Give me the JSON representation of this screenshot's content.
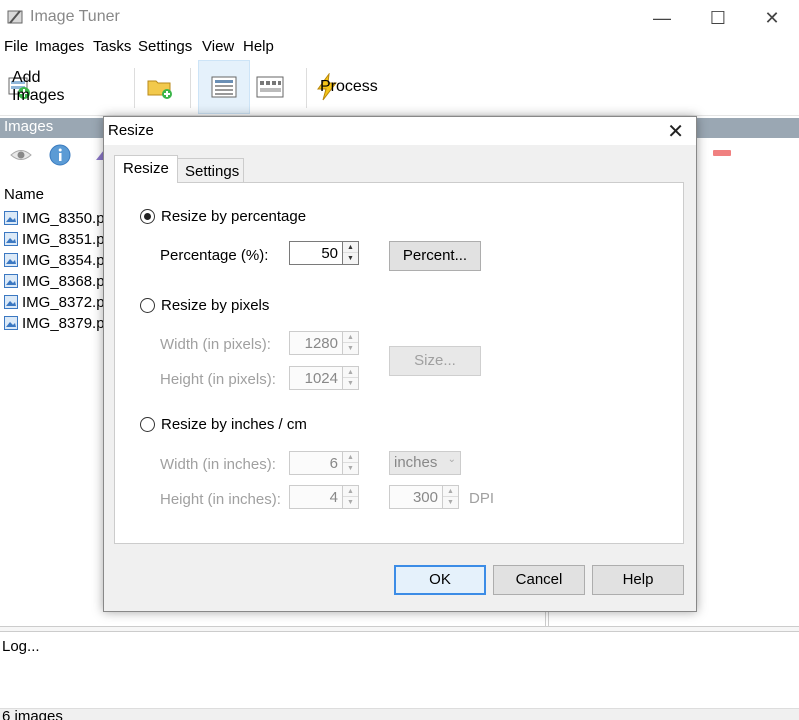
{
  "app": {
    "title": "Image Tuner",
    "window_controls": {
      "minimize": "—",
      "maximize": "☐",
      "close": "✕"
    }
  },
  "menu": [
    "File",
    "Images",
    "Tasks",
    "Settings",
    "View",
    "Help"
  ],
  "toolbar": {
    "add_images_label": "Add Images",
    "process_label": "Process"
  },
  "images_panel": {
    "header": "Images",
    "column_name": "Name",
    "files": [
      "IMG_8350.p",
      "IMG_8351.p",
      "IMG_8354.p",
      "IMG_8368.p",
      "IMG_8372.p",
      "IMG_8379.p"
    ]
  },
  "log": {
    "label": "Log..."
  },
  "status": {
    "text": "6 images"
  },
  "dialog": {
    "title": "Resize",
    "close": "✕",
    "tabs": [
      "Resize",
      "Settings"
    ],
    "by_percentage": {
      "label": "Resize by percentage",
      "selected": true,
      "percentage_label": "Percentage (%):",
      "percentage_value": "50",
      "button": "Percent..."
    },
    "by_pixels": {
      "label": "Resize by pixels",
      "width_label": "Width (in pixels):",
      "width_value": "1280",
      "height_label": "Height (in pixels):",
      "height_value": "1024",
      "button": "Size..."
    },
    "by_inches": {
      "label": "Resize by inches / cm",
      "width_label": "Width (in inches):",
      "width_value": "6",
      "height_label": "Height (in inches):",
      "height_value": "4",
      "unit_select": "inches",
      "dpi_value": "300",
      "dpi_label": "DPI"
    },
    "buttons": {
      "ok": "OK",
      "cancel": "Cancel",
      "help": "Help"
    }
  },
  "colors": {
    "images_header_bg": "#9aa7b3",
    "ok_border": "#3c8ce6"
  }
}
